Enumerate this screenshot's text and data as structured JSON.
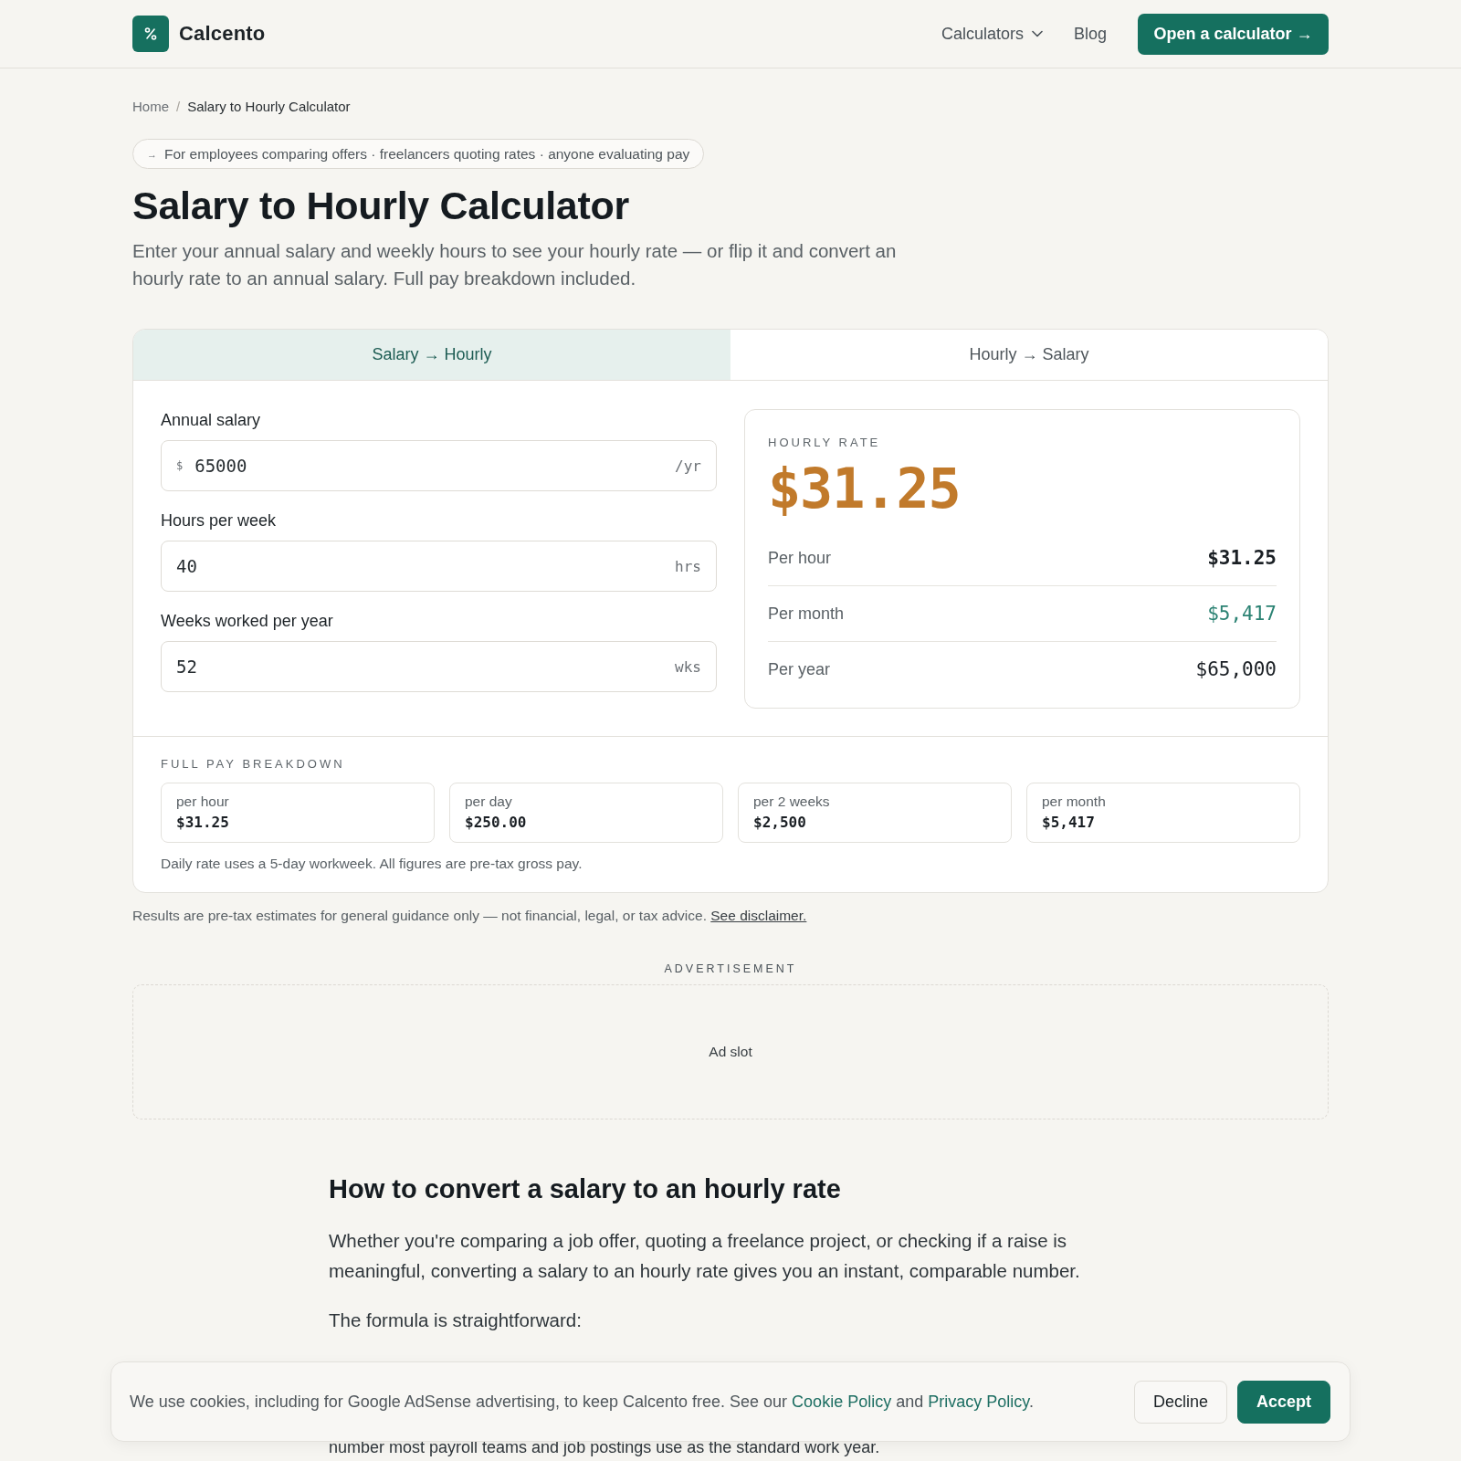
{
  "header": {
    "brand": "Calcento",
    "nav": [
      {
        "label": "Calculators",
        "kind": "dropdown"
      },
      {
        "label": "Blog",
        "kind": "link"
      }
    ],
    "cta": "Open a calculator →"
  },
  "breadcrumb": {
    "separator": "/",
    "items": [
      {
        "label": "Home",
        "current": false
      },
      {
        "label": "Salary to Hourly Calculator",
        "current": true
      }
    ]
  },
  "audience_pill": {
    "arrow": "→",
    "text": "For employees comparing offers · freelancers quoting rates · anyone evaluating pay"
  },
  "title": "Salary to Hourly Calculator",
  "intro": "Enter your annual salary and weekly hours to see your hourly rate — or flip it and convert an hourly rate to an annual salary. Full pay breakdown included.",
  "calculator": {
    "tabs": [
      {
        "label": "Salary → Hourly",
        "selected": true
      },
      {
        "label": "Hourly → Salary",
        "selected": false
      }
    ],
    "fields": [
      {
        "label": "Annual salary",
        "prefix": "$",
        "value": "65000",
        "suffix": "/yr"
      },
      {
        "label": "Hours per week",
        "value": "40",
        "suffix": "hrs"
      },
      {
        "label": "Weeks worked per year",
        "value": "52",
        "suffix": "wks"
      }
    ],
    "result": {
      "label": "HOURLY RATE",
      "value": "$31.25",
      "rows": [
        {
          "label": "Per hour",
          "value": "$31.25",
          "kind": "strong"
        },
        {
          "label": "Per month",
          "value": "$5,417",
          "kind": "accent"
        },
        {
          "label": "Per year",
          "value": "$65,000",
          "kind": "plain"
        }
      ]
    },
    "breakdown": {
      "title": "FULL PAY BREAKDOWN",
      "tiles": [
        {
          "label": "per hour",
          "value": "$31.25"
        },
        {
          "label": "per day",
          "value": "$250.00"
        },
        {
          "label": "per 2 weeks",
          "value": "$2,500"
        },
        {
          "label": "per month",
          "value": "$5,417"
        }
      ],
      "note": "Daily rate uses a 5-day workweek. All figures are pre-tax gross pay."
    }
  },
  "disclaimer": {
    "text": "Results are pre-tax estimates for general guidance only — not financial, legal, or tax advice.",
    "link": "See disclaimer."
  },
  "advertisement": {
    "label": "ADVERTISEMENT",
    "slot": "Ad slot"
  },
  "article": {
    "heading": "How to convert a salary to an hourly rate",
    "paragraphs": [
      "Whether you're comparing a job offer, quoting a freelance project, or checking if a raise is meaningful, converting a salary to an hourly rate gives you an instant, comparable number.",
      "The formula is straightforward:"
    ],
    "continued": "number most payroll teams and job postings use as the standard work year."
  },
  "cookie_banner": {
    "message": [
      {
        "kind": "text",
        "text": "We use cookies, including for Google AdSense advertising, to keep Calcento free. See our "
      },
      {
        "kind": "link",
        "text": "Cookie Policy"
      },
      {
        "kind": "text",
        "text": " and "
      },
      {
        "kind": "link",
        "text": "Privacy Policy"
      },
      {
        "kind": "text",
        "text": "."
      }
    ],
    "buttons": [
      {
        "label": "Decline",
        "kind": "secondary"
      },
      {
        "label": "Accept",
        "kind": "primary"
      }
    ]
  }
}
